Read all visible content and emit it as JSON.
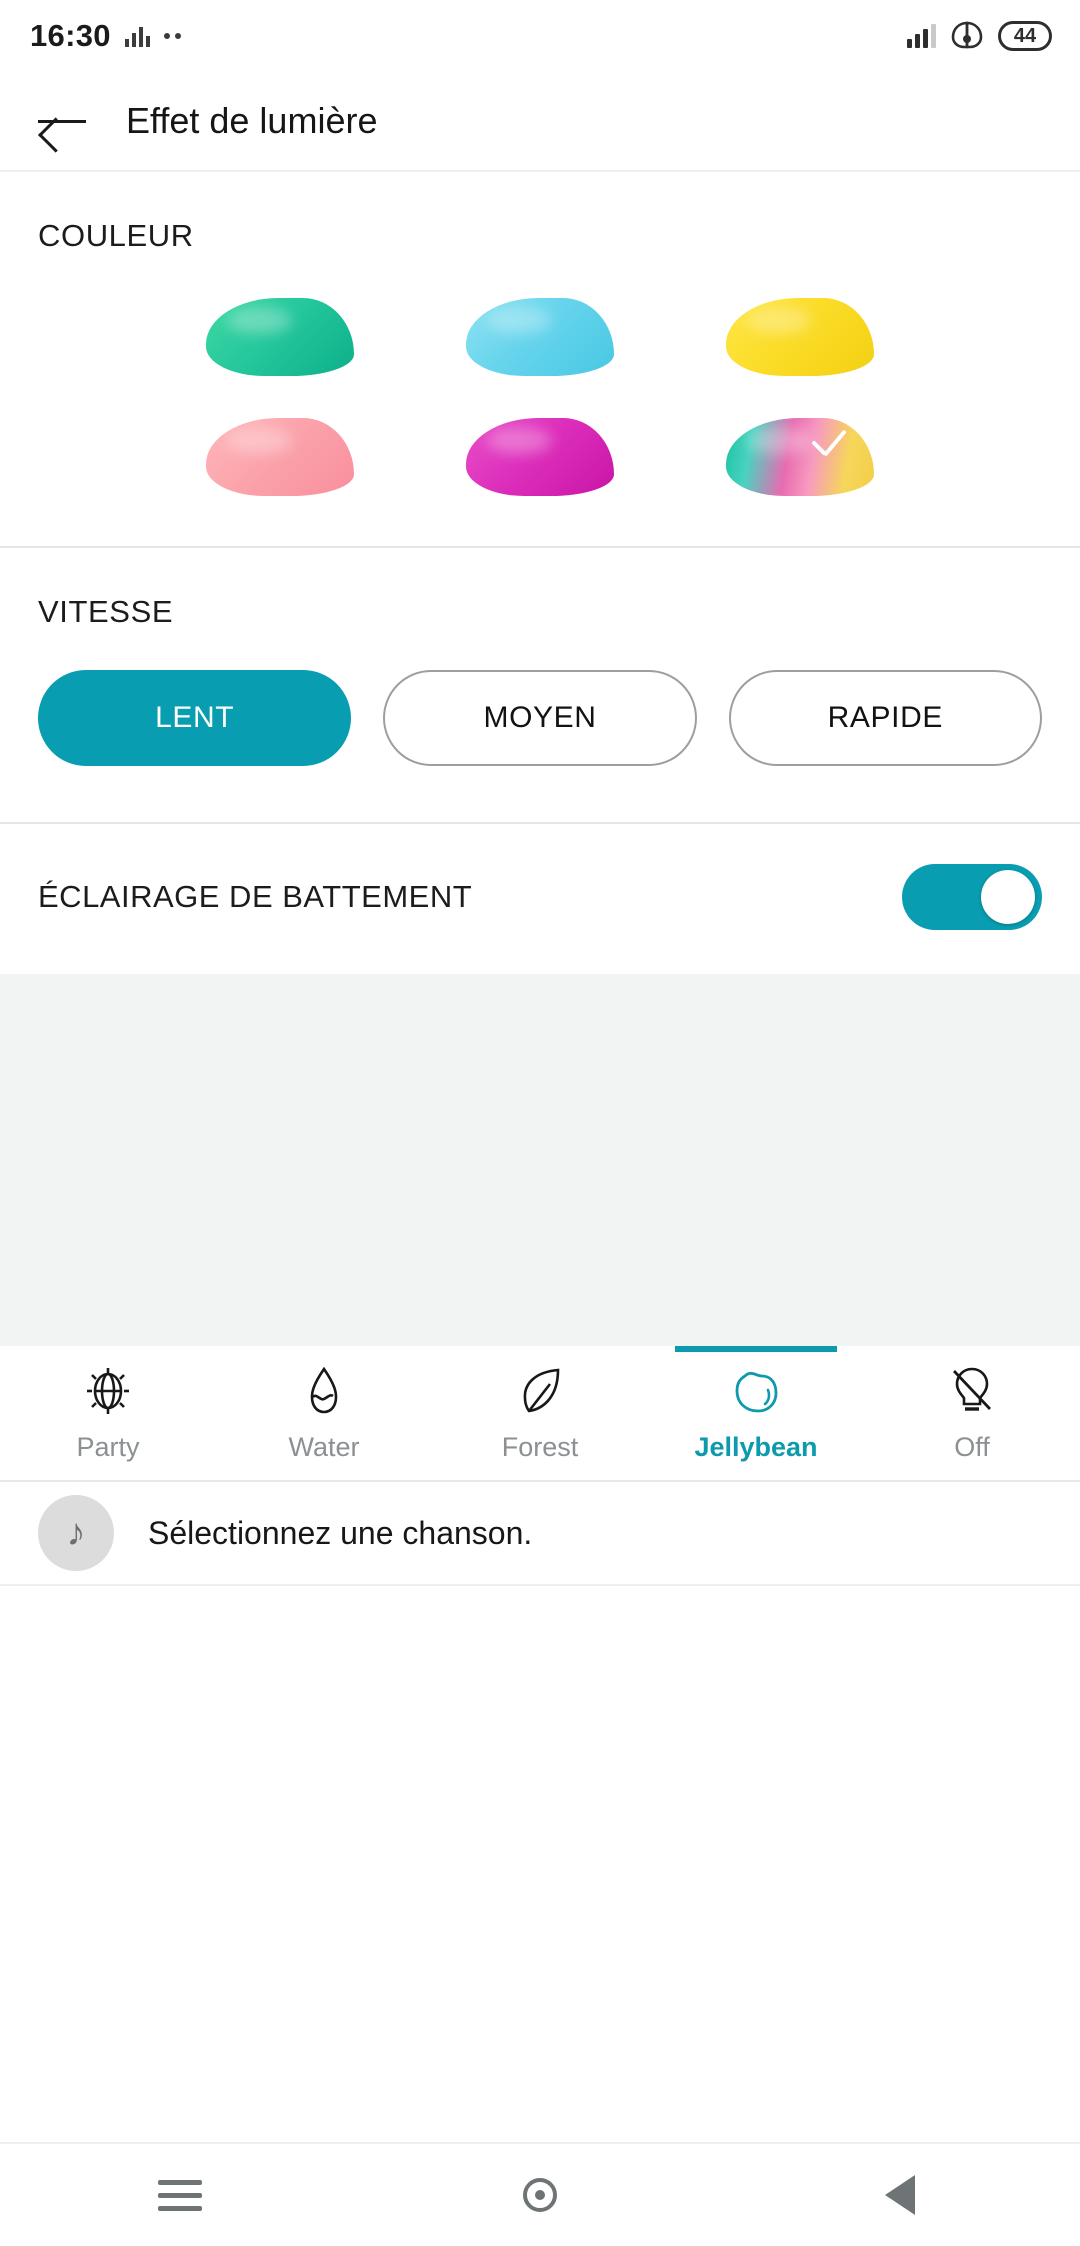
{
  "status_bar": {
    "time": "16:30",
    "battery_level": "44",
    "icons": [
      "equalizer-icon",
      "dots-icon",
      "signal-icon",
      "wifi-icon",
      "battery-icon"
    ]
  },
  "app_bar": {
    "back_label": "←",
    "title": "Effet de lumière"
  },
  "color_section": {
    "label": "COULEUR",
    "swatches": [
      {
        "name": "green",
        "selected": false,
        "gradient": "linear-gradient(135deg,#3fd9a4 0%,#25c79c 45%,#0cb089 100%)"
      },
      {
        "name": "cyan",
        "selected": false,
        "gradient": "linear-gradient(135deg,#8fe3f2 0%,#66d4ec 45%,#49c8e4 100%)"
      },
      {
        "name": "yellow",
        "selected": false,
        "gradient": "linear-gradient(135deg,#ffe74a 0%,#fbdc27 45%,#f3d013 100%)"
      },
      {
        "name": "pink",
        "selected": false,
        "gradient": "linear-gradient(135deg,#ffb8bd 0%,#fba3ab 45%,#f98f9c 100%)"
      },
      {
        "name": "magenta",
        "selected": false,
        "gradient": "linear-gradient(135deg,#e84fc8 0%,#dd2fbb 45%,#c915a8 100%)"
      },
      {
        "name": "rainbow",
        "selected": true,
        "gradient": "linear-gradient(100deg,#19c3a0 0%,#4ad2c0 18%,#e86bb0 42%,#f79ac0 58%,#f6d65a 80%,#f2cf4a 100%)"
      }
    ]
  },
  "speed_section": {
    "label": "VITESSE",
    "options": [
      {
        "label": "LENT",
        "selected": true
      },
      {
        "label": "MOYEN",
        "selected": false
      },
      {
        "label": "RAPIDE",
        "selected": false
      }
    ]
  },
  "beat_section": {
    "label": "ÉCLAIRAGE DE BATTEMENT",
    "toggle_on": true
  },
  "tab_bar": {
    "tabs": [
      {
        "label": "Party",
        "icon": "party-sun-icon",
        "active": false
      },
      {
        "label": "Water",
        "icon": "water-drop-icon",
        "active": false
      },
      {
        "label": "Forest",
        "icon": "leaf-icon",
        "active": false
      },
      {
        "label": "Jellybean",
        "icon": "jellybean-icon",
        "active": true
      },
      {
        "label": "Off",
        "icon": "bulb-off-icon",
        "active": false
      }
    ]
  },
  "song_row": {
    "icon": "music-note-icon",
    "icon_glyph": "♪",
    "text": "Sélectionnez une chanson."
  },
  "nav_bar": {
    "buttons": [
      "menu-icon",
      "home-icon",
      "back-icon"
    ]
  },
  "colors": {
    "accent": "#089db0",
    "tab_active": "#0d9aad",
    "muted_text": "#8b9093",
    "filler_bg": "#f2f3f3"
  }
}
